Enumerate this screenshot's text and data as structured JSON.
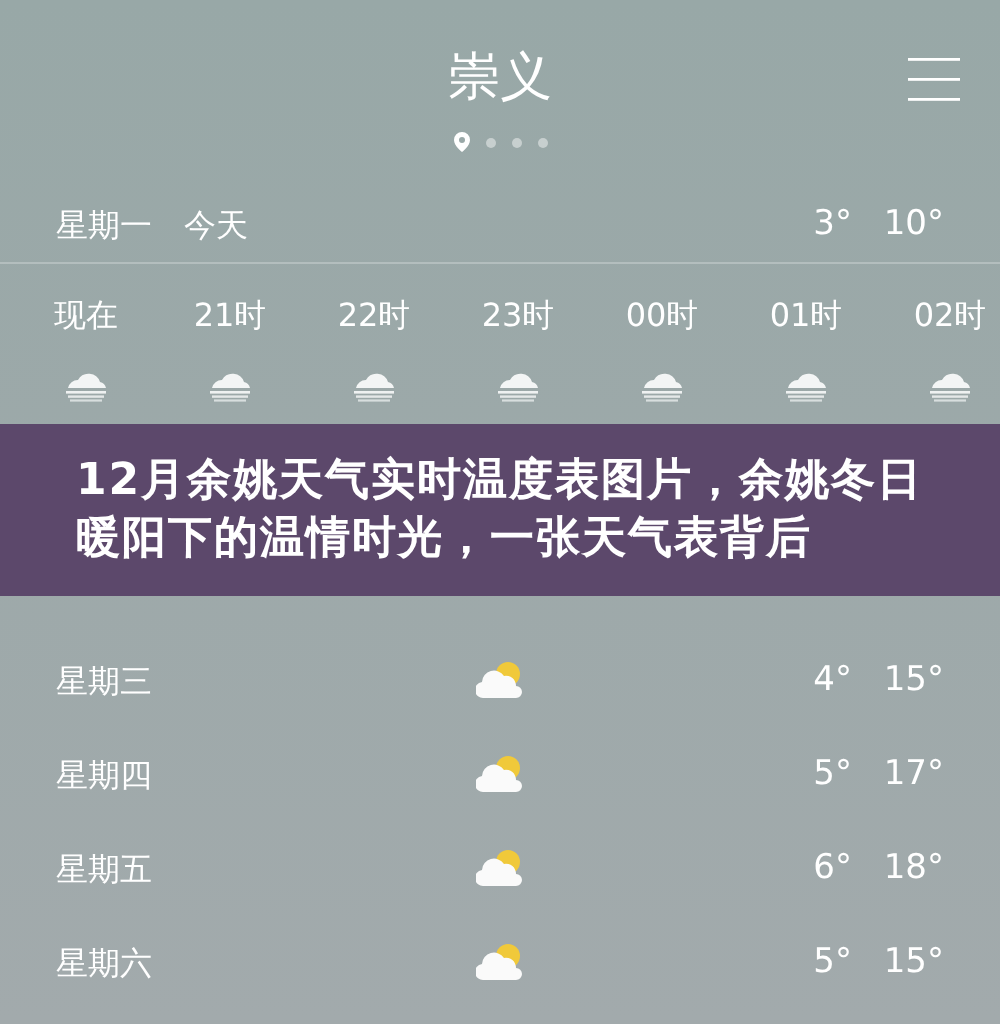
{
  "header": {
    "city": "崇义",
    "page_dots": [
      {
        "kind": "location",
        "selected": true
      },
      {
        "kind": "dot",
        "selected": false
      },
      {
        "kind": "dot",
        "selected": false
      },
      {
        "kind": "dot",
        "selected": false
      }
    ]
  },
  "today": {
    "day": "星期一",
    "label": "今天",
    "low": "3°",
    "high": "10°"
  },
  "hourly": [
    {
      "time": "现在",
      "kind": "fog"
    },
    {
      "time": "21时",
      "kind": "fog"
    },
    {
      "time": "22时",
      "kind": "fog"
    },
    {
      "time": "23时",
      "kind": "fog"
    },
    {
      "time": "00时",
      "kind": "fog"
    },
    {
      "time": "01时",
      "kind": "fog"
    },
    {
      "time": "02时",
      "kind": "fog"
    }
  ],
  "banner": {
    "text": "12月余姚天气实时温度表图片，余姚冬日暖阳下的温情时光，一张天气表背后"
  },
  "daily": [
    {
      "day": "星期三",
      "kind": "partly-cloudy",
      "low": "4°",
      "high": "15°"
    },
    {
      "day": "星期四",
      "kind": "partly-cloudy",
      "low": "5°",
      "high": "17°"
    },
    {
      "day": "星期五",
      "kind": "partly-cloudy",
      "low": "6°",
      "high": "18°"
    },
    {
      "day": "星期六",
      "kind": "partly-cloudy",
      "low": "5°",
      "high": "15°"
    }
  ]
}
